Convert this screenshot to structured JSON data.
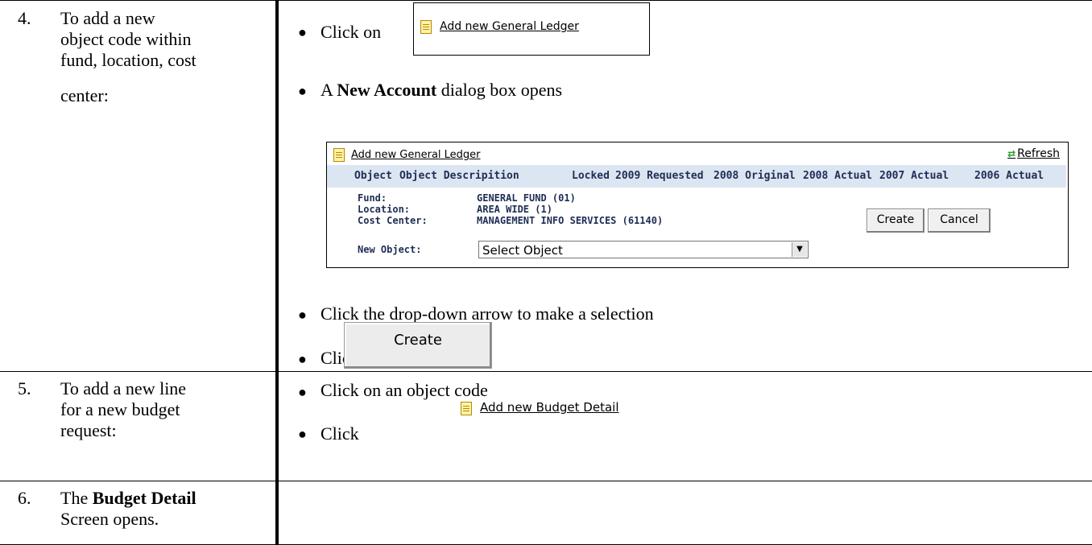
{
  "steps": [
    {
      "num": "4.",
      "lines": [
        "To add a new",
        "object code within",
        "fund, location, cost",
        "center:"
      ]
    },
    {
      "num": "5.",
      "lines": [
        "To add a new line",
        "for a new budget",
        "request:"
      ]
    },
    {
      "num": "6.",
      "pre": "The ",
      "bold": "Budget Detail",
      "post": "Screen opens."
    }
  ],
  "step4": {
    "click_on": "Click on",
    "add_gl_link": "Add new General Ledger",
    "dialog_pre": "A ",
    "dialog_bold": "New Account",
    "dialog_post": " dialog box opens",
    "dropdown_text": "Click the drop-down arrow to make a selection",
    "click": "Click",
    "create_img_label": "Create"
  },
  "dialog": {
    "link": "Add new General Ledger",
    "refresh": "Refresh",
    "columns": [
      "Object",
      "Object Descripition",
      "Locked",
      "2009 Requested",
      "2008 Original",
      "2008 Actual",
      "2007 Actual",
      "2006 Actual"
    ],
    "fields": [
      {
        "label": "Fund:",
        "value": "GENERAL FUND (01)"
      },
      {
        "label": "Location:",
        "value": "AREA WIDE (1)"
      },
      {
        "label": "Cost Center:",
        "value": "MANAGEMENT INFO SERVICES (61140)"
      },
      {
        "label": "New Object:",
        "value": ""
      }
    ],
    "select_value": "Select Object",
    "create": "Create",
    "cancel": "Cancel"
  },
  "step5": {
    "click_object": "Click on an object code",
    "click": "Click",
    "add_budget_link": "Add new Budget Detail"
  }
}
